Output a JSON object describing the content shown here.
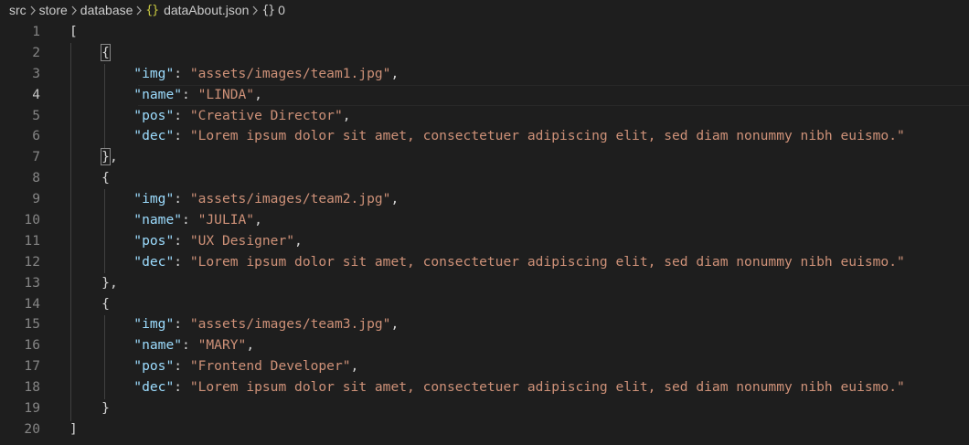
{
  "breadcrumb": {
    "items": [
      "src",
      "store",
      "database",
      "dataAbout.json",
      "0"
    ],
    "file_icon": "{}",
    "symbol_icon": "{}"
  },
  "editor": {
    "current_line": 4,
    "lines": [
      {
        "n": "1",
        "tokens": [
          {
            "t": "[",
            "c": "punc"
          }
        ]
      },
      {
        "n": "2",
        "tokens": [
          {
            "t": "    ",
            "c": "punc"
          },
          {
            "t": "{",
            "c": "punc",
            "box": true
          }
        ]
      },
      {
        "n": "3",
        "tokens": [
          {
            "t": "        ",
            "c": "punc"
          },
          {
            "t": "\"img\"",
            "c": "key"
          },
          {
            "t": ": ",
            "c": "punc"
          },
          {
            "t": "\"assets/images/team1.jpg\"",
            "c": "str"
          },
          {
            "t": ",",
            "c": "punc"
          }
        ]
      },
      {
        "n": "4",
        "tokens": [
          {
            "t": "        ",
            "c": "punc"
          },
          {
            "t": "\"name\"",
            "c": "key"
          },
          {
            "t": ": ",
            "c": "punc"
          },
          {
            "t": "\"LINDA\"",
            "c": "str"
          },
          {
            "t": ",",
            "c": "punc"
          }
        ]
      },
      {
        "n": "5",
        "tokens": [
          {
            "t": "        ",
            "c": "punc"
          },
          {
            "t": "\"pos\"",
            "c": "key"
          },
          {
            "t": ": ",
            "c": "punc"
          },
          {
            "t": "\"Creative Director\"",
            "c": "str"
          },
          {
            "t": ",",
            "c": "punc"
          }
        ]
      },
      {
        "n": "6",
        "tokens": [
          {
            "t": "        ",
            "c": "punc"
          },
          {
            "t": "\"dec\"",
            "c": "key"
          },
          {
            "t": ": ",
            "c": "punc"
          },
          {
            "t": "\"Lorem ipsum dolor sit amet, consectetuer adipiscing elit, sed diam nonummy nibh euismo.\"",
            "c": "str"
          }
        ]
      },
      {
        "n": "7",
        "tokens": [
          {
            "t": "    ",
            "c": "punc"
          },
          {
            "t": "}",
            "c": "punc",
            "box": true
          },
          {
            "t": ",",
            "c": "punc"
          }
        ]
      },
      {
        "n": "8",
        "tokens": [
          {
            "t": "    ",
            "c": "punc"
          },
          {
            "t": "{",
            "c": "punc"
          }
        ]
      },
      {
        "n": "9",
        "tokens": [
          {
            "t": "        ",
            "c": "punc"
          },
          {
            "t": "\"img\"",
            "c": "key"
          },
          {
            "t": ": ",
            "c": "punc"
          },
          {
            "t": "\"assets/images/team2.jpg\"",
            "c": "str"
          },
          {
            "t": ",",
            "c": "punc"
          }
        ]
      },
      {
        "n": "10",
        "tokens": [
          {
            "t": "        ",
            "c": "punc"
          },
          {
            "t": "\"name\"",
            "c": "key"
          },
          {
            "t": ": ",
            "c": "punc"
          },
          {
            "t": "\"JULIA\"",
            "c": "str"
          },
          {
            "t": ",",
            "c": "punc"
          }
        ]
      },
      {
        "n": "11",
        "tokens": [
          {
            "t": "        ",
            "c": "punc"
          },
          {
            "t": "\"pos\"",
            "c": "key"
          },
          {
            "t": ": ",
            "c": "punc"
          },
          {
            "t": "\"UX Designer\"",
            "c": "str"
          },
          {
            "t": ",",
            "c": "punc"
          }
        ]
      },
      {
        "n": "12",
        "tokens": [
          {
            "t": "        ",
            "c": "punc"
          },
          {
            "t": "\"dec\"",
            "c": "key"
          },
          {
            "t": ": ",
            "c": "punc"
          },
          {
            "t": "\"Lorem ipsum dolor sit amet, consectetuer adipiscing elit, sed diam nonummy nibh euismo.\"",
            "c": "str"
          }
        ]
      },
      {
        "n": "13",
        "tokens": [
          {
            "t": "    ",
            "c": "punc"
          },
          {
            "t": "}",
            "c": "punc"
          },
          {
            "t": ",",
            "c": "punc"
          }
        ]
      },
      {
        "n": "14",
        "tokens": [
          {
            "t": "    ",
            "c": "punc"
          },
          {
            "t": "{",
            "c": "punc"
          }
        ]
      },
      {
        "n": "15",
        "tokens": [
          {
            "t": "        ",
            "c": "punc"
          },
          {
            "t": "\"img\"",
            "c": "key"
          },
          {
            "t": ": ",
            "c": "punc"
          },
          {
            "t": "\"assets/images/team3.jpg\"",
            "c": "str"
          },
          {
            "t": ",",
            "c": "punc"
          }
        ]
      },
      {
        "n": "16",
        "tokens": [
          {
            "t": "        ",
            "c": "punc"
          },
          {
            "t": "\"name\"",
            "c": "key"
          },
          {
            "t": ": ",
            "c": "punc"
          },
          {
            "t": "\"MARY\"",
            "c": "str"
          },
          {
            "t": ",",
            "c": "punc"
          }
        ]
      },
      {
        "n": "17",
        "tokens": [
          {
            "t": "        ",
            "c": "punc"
          },
          {
            "t": "\"pos\"",
            "c": "key"
          },
          {
            "t": ": ",
            "c": "punc"
          },
          {
            "t": "\"Frontend Developer\"",
            "c": "str"
          },
          {
            "t": ",",
            "c": "punc"
          }
        ]
      },
      {
        "n": "18",
        "tokens": [
          {
            "t": "        ",
            "c": "punc"
          },
          {
            "t": "\"dec\"",
            "c": "key"
          },
          {
            "t": ": ",
            "c": "punc"
          },
          {
            "t": "\"Lorem ipsum dolor sit amet, consectetuer adipiscing elit, sed diam nonummy nibh euismo.\"",
            "c": "str"
          }
        ]
      },
      {
        "n": "19",
        "tokens": [
          {
            "t": "    ",
            "c": "punc"
          },
          {
            "t": "}",
            "c": "punc"
          }
        ]
      },
      {
        "n": "20",
        "tokens": [
          {
            "t": "]",
            "c": "punc"
          }
        ]
      }
    ]
  },
  "colors": {
    "background": "#1e1e1e",
    "key": "#9cdcfe",
    "string": "#ce9178",
    "punctuation": "#d4d4d4",
    "line_number": "#858585",
    "json_icon": "#cbcb41"
  }
}
